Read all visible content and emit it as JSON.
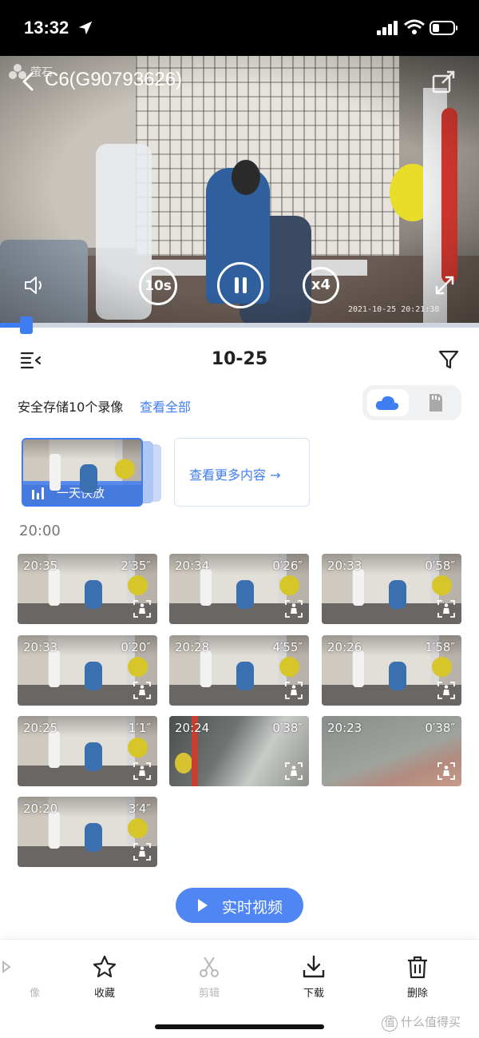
{
  "status_bar": {
    "time": "13:32"
  },
  "player": {
    "brand": "萤石",
    "camera_title": "C6(G90793626)",
    "rewind_label": "10s",
    "speed_label": "x4",
    "timestamp": "2021-10-25 20:21:38",
    "progress_fraction": 0.055
  },
  "date_bar": {
    "date": "10-25"
  },
  "storage": {
    "summary": "安全存储10个录像",
    "view_all": "查看全部",
    "selected_source": "cloud"
  },
  "fast_play": {
    "label": "一天快放",
    "more_label": "查看更多内容 →"
  },
  "hour_header": "20:00",
  "clips": [
    {
      "time": "20:35",
      "duration": "2′35″",
      "thumb": "room"
    },
    {
      "time": "20:34",
      "duration": "0′26″",
      "thumb": "room"
    },
    {
      "time": "20:33",
      "duration": "0′58″",
      "thumb": "room"
    },
    {
      "time": "20:33",
      "duration": "0′20″",
      "thumb": "room"
    },
    {
      "time": "20:28",
      "duration": "4′55″",
      "thumb": "room"
    },
    {
      "time": "20:26",
      "duration": "1′58″",
      "thumb": "room"
    },
    {
      "time": "20:25",
      "duration": "1′1″",
      "thumb": "room"
    },
    {
      "time": "20:24",
      "duration": "0′38″",
      "thumb": "dark"
    },
    {
      "time": "20:23",
      "duration": "0′38″",
      "thumb": "blur"
    },
    {
      "time": "20:20",
      "duration": "3′4″",
      "thumb": "room"
    }
  ],
  "live_button": {
    "label": "实时视频"
  },
  "toolbar": {
    "items": [
      {
        "label": "像",
        "icon": "record-icon",
        "enabled": false
      },
      {
        "label": "收藏",
        "icon": "star-icon",
        "enabled": true
      },
      {
        "label": "剪辑",
        "icon": "scissors-icon",
        "enabled": false
      },
      {
        "label": "下载",
        "icon": "download-icon",
        "enabled": true
      },
      {
        "label": "删除",
        "icon": "trash-icon",
        "enabled": true
      }
    ]
  },
  "watermark": {
    "badge": "值",
    "text": "什么值得买"
  },
  "colors": {
    "accent": "#3f7df2",
    "live_button": "#4f86f4"
  }
}
